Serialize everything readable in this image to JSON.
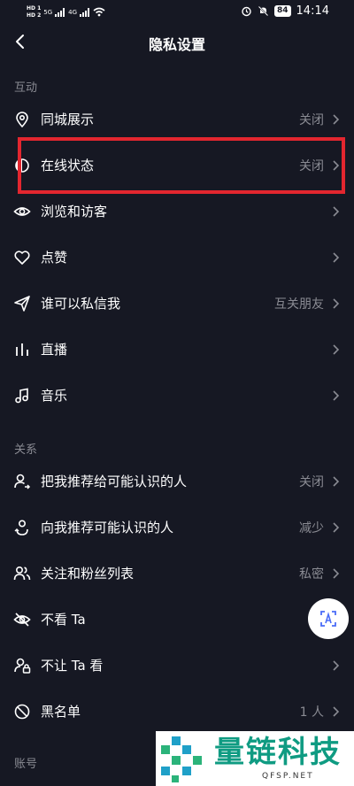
{
  "status_bar": {
    "hd1": "HD 1",
    "hd2": "HD 2",
    "net1": "5G",
    "net2": "4G",
    "battery": "84",
    "time": "14:14"
  },
  "header": {
    "title": "隐私设置"
  },
  "sections": {
    "interaction": "互动",
    "relations": "关系",
    "account": "账号"
  },
  "rows": [
    {
      "label": "同城展示",
      "value": "关闭",
      "icon": "location-pin-icon"
    },
    {
      "label": "在线状态",
      "value": "关闭",
      "icon": "online-status-icon"
    },
    {
      "label": "浏览和访客",
      "value": "",
      "icon": "eye-icon"
    },
    {
      "label": "点赞",
      "value": "",
      "icon": "heart-icon"
    },
    {
      "label": "谁可以私信我",
      "value": "互关朋友",
      "icon": "send-icon"
    },
    {
      "label": "直播",
      "value": "",
      "icon": "live-bars-icon"
    },
    {
      "label": "音乐",
      "value": "",
      "icon": "music-note-icon"
    },
    {
      "label": "把我推荐给可能认识的人",
      "value": "关闭",
      "icon": "person-share-icon"
    },
    {
      "label": "向我推荐可能认识的人",
      "value": "减少",
      "icon": "person-recommend-icon"
    },
    {
      "label": "关注和粉丝列表",
      "value": "私密",
      "icon": "people-icon"
    },
    {
      "label": "不看 Ta",
      "value": "",
      "icon": "eye-off-icon"
    },
    {
      "label": "不让 Ta 看",
      "value": "",
      "icon": "person-lock-icon"
    },
    {
      "label": "黑名单",
      "value": "1 人",
      "icon": "block-icon"
    }
  ],
  "watermark": {
    "text": "量链科技",
    "sub": "QFSP.NET"
  },
  "colors": {
    "background": "#161823",
    "highlight": "#e3262f",
    "muted": "#8a8b93",
    "brand": "#0f9b82"
  }
}
